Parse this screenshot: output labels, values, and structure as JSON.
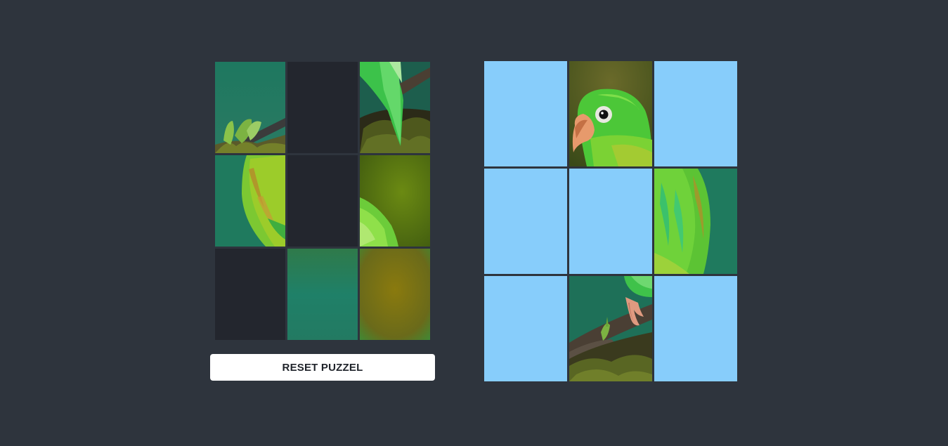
{
  "reset_button_label": "RESET PUZZEL",
  "colors": {
    "background": "#2e343d",
    "empty_tray_slot": "#23262e",
    "empty_board_cell": "#87cdfb",
    "button": "#ffffff"
  },
  "tray": {
    "slots": [
      {
        "piece": "parrot-piece-branch-leaves"
      },
      {
        "piece": null
      },
      {
        "piece": "parrot-piece-tail-branch"
      },
      {
        "piece": "parrot-piece-wing-left"
      },
      {
        "piece": null
      },
      {
        "piece": "parrot-piece-back-olive"
      },
      {
        "piece": null
      },
      {
        "piece": "parrot-piece-teal-background"
      },
      {
        "piece": "parrot-piece-olive-background"
      }
    ]
  },
  "board": {
    "cells": [
      {
        "piece": null
      },
      {
        "piece": "parrot-piece-head"
      },
      {
        "piece": null
      },
      {
        "piece": null
      },
      {
        "piece": null
      },
      {
        "piece": "parrot-piece-body-right"
      },
      {
        "piece": null
      },
      {
        "piece": "parrot-piece-feet-branch"
      },
      {
        "piece": null
      }
    ]
  }
}
